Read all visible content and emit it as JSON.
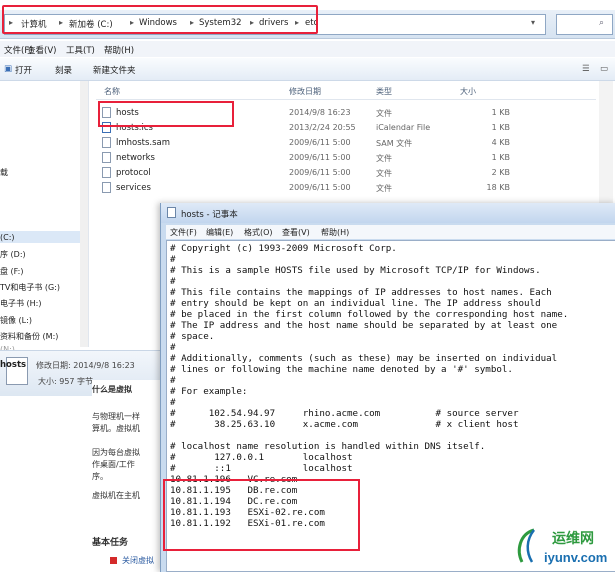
{
  "address": {
    "crumbs": [
      "计算机",
      "新加卷 (C:)",
      "Windows",
      "System32",
      "drivers",
      "etc"
    ]
  },
  "menu": [
    "文件(F)",
    "查看(V)",
    "工具(T)",
    "帮助(H)"
  ],
  "toolbar": [
    "打开",
    "刻录",
    "新建文件夹"
  ],
  "nav": [
    "载",
    "(C:)",
    "序 (D:)",
    "盘 (F:)",
    "TV和电子书 (G:)",
    "电子书 (H:)",
    "镜像 (L:)",
    "资料和备份 (M:)",
    "(N:)"
  ],
  "columns": {
    "name": "名称",
    "date": "修改日期",
    "type": "类型",
    "size": "大小"
  },
  "files": [
    {
      "name": "hosts",
      "date": "2014/9/8 16:23",
      "type": "文件",
      "size": "1 KB"
    },
    {
      "name": "hosts.ics",
      "date": "2013/2/24 20:55",
      "type": "iCalendar File",
      "size": "1 KB"
    },
    {
      "name": "lmhosts.sam",
      "date": "2009/6/11 5:00",
      "type": "SAM 文件",
      "size": "4 KB"
    },
    {
      "name": "networks",
      "date": "2009/6/11 5:00",
      "type": "文件",
      "size": "1 KB"
    },
    {
      "name": "protocol",
      "date": "2009/6/11 5:00",
      "type": "文件",
      "size": "2 KB"
    },
    {
      "name": "services",
      "date": "2009/6/11 5:00",
      "type": "文件",
      "size": "18 KB"
    }
  ],
  "status": {
    "name": "hosts",
    "date": "修改日期: 2014/9/8 16:23",
    "size": "大小: 957 字节"
  },
  "behind": [
    "什么是虚拟",
    "与物理机一样",
    "算机。虚拟机",
    "因为每台虚拟",
    "作桌面/工作",
    "序。",
    "虚拟机在主机",
    "基本任务",
    "关闭虚拟"
  ],
  "notepad": {
    "title": "hosts - 记事本",
    "menu": [
      "文件(F)",
      "编辑(E)",
      "格式(O)",
      "查看(V)",
      "帮助(H)"
    ],
    "lines": [
      "# Copyright (c) 1993-2009 Microsoft Corp.",
      "#",
      "# This is a sample HOSTS file used by Microsoft TCP/IP for Windows.",
      "#",
      "# This file contains the mappings of IP addresses to host names. Each",
      "# entry should be kept on an individual line. The IP address should",
      "# be placed in the first column followed by the corresponding host name.",
      "# The IP address and the host name should be separated by at least one",
      "# space.",
      "#",
      "# Additionally, comments (such as these) may be inserted on individual",
      "# lines or following the machine name denoted by a '#' symbol.",
      "#",
      "# For example:",
      "#",
      "#      102.54.94.97     rhino.acme.com          # source server",
      "#       38.25.63.10     x.acme.com              # x client host",
      "",
      "# localhost name resolution is handled within DNS itself.",
      "#\t127.0.0.1       localhost",
      "#\t::1             localhost",
      "10.81.1.196   VC.re.com",
      "10.81.1.195   DB.re.com",
      "10.81.1.194   DC.re.com",
      "10.81.1.193   ESXi-02.re.com",
      "10.81.1.192   ESXi-01.re.com"
    ]
  },
  "watermark": {
    "brand": "运维网",
    "domain": "iyunv.com"
  },
  "colors": {
    "highlight": "#e8203a",
    "brand_green": "#2e9a3f",
    "brand_blue": "#1a6fb0"
  }
}
